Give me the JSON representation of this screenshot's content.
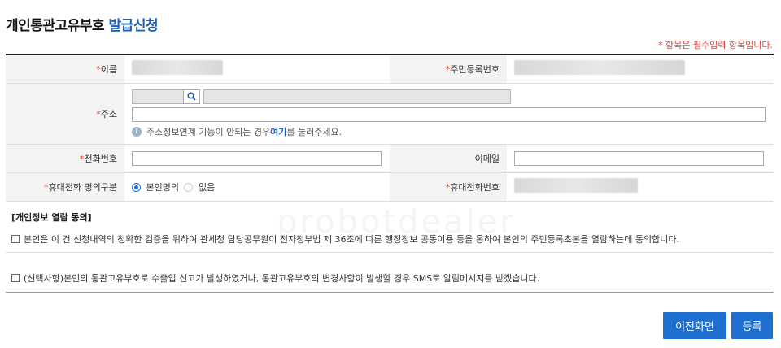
{
  "page": {
    "title_main": "개인통관고유부호",
    "title_accent": "발급신청",
    "required_note": "* 항목은 필수입력 항목입니다.",
    "watermark": "probotdealer"
  },
  "form": {
    "name_label": "이름",
    "rrn_label": "주민등록번호",
    "address_label": "주소",
    "address_info_prefix": "주소정보연계 기능이 안되는 경우 ",
    "address_info_link": "여기",
    "address_info_suffix": "를 눌러주세요.",
    "phone_label": "전화번호",
    "email_label": "이메일",
    "ownership_label": "휴대전화 명의구분",
    "ownership_option_self": "본인명의",
    "ownership_option_none": "없음",
    "ownership_selected": "본인명의",
    "mobile_label": "휴대전화번호",
    "required_mark": "*"
  },
  "consent": {
    "title": "[개인정보 열람 동의]",
    "item1": "본인은 이 건 신청내역의 정확한 검증을 위하여 관세청 담당공무원이 전자정부법 제 36조에 따른 행정정보 공동이용 등을 통하여 본인의 주민등록초본을 열람하는데 동의합니다.",
    "item2": "(선택사항)본인의 통관고유부호로 수출입 신고가 발생하였거나, 통관고유부호의 변경사항이 발생할 경우 SMS로 알림메시지를 받겠습니다."
  },
  "buttons": {
    "prev": "이전화면",
    "submit": "등록"
  },
  "colors": {
    "accent": "#1f5fb8",
    "required": "#e0463a",
    "button": "#1f6fd1"
  }
}
